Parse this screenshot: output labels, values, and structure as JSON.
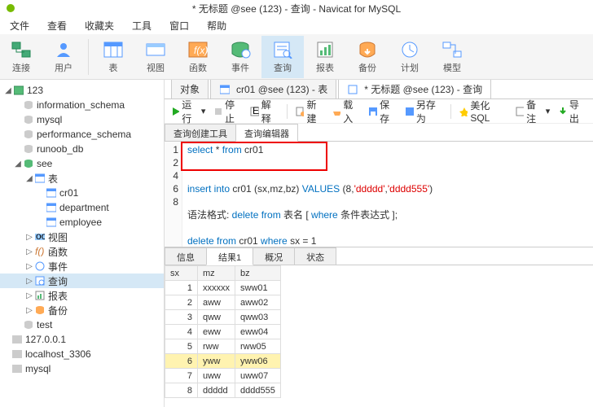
{
  "titlebar": "* 无标题 @see (123) - 查询 - Navicat for MySQL",
  "menu": {
    "file": "文件",
    "view": "查看",
    "fav": "收藏夹",
    "tool": "工具",
    "window": "窗口",
    "help": "帮助"
  },
  "ribbon": {
    "conn": "连接",
    "user": "用户",
    "table": "表",
    "view": "视图",
    "func": "函数",
    "event": "事件",
    "query": "查询",
    "report": "报表",
    "backup": "备份",
    "plan": "计划",
    "model": "模型"
  },
  "tree": {
    "root": "123",
    "dbs": [
      "information_schema",
      "mysql",
      "performance_schema",
      "runoob_db"
    ],
    "see": "see",
    "tables_label": "表",
    "tables": [
      "cr01",
      "department",
      "employee"
    ],
    "views": "视图",
    "funcs": "函数",
    "events": "事件",
    "queries": "查询",
    "reports": "报表",
    "backups": "备份",
    "test": "test",
    "hosts": [
      "127.0.0.1",
      "localhost_3306",
      "mysql"
    ]
  },
  "tabs": {
    "objects": "对象",
    "t1": "cr01 @see (123) - 表",
    "t2": "* 无标题 @see (123) - 查询"
  },
  "toolbar": {
    "run": "运行",
    "stop": "停止",
    "explain": "解释",
    "new": "新建",
    "load": "载入",
    "save": "保存",
    "saveas": "另存为",
    "beautify": "美化 SQL",
    "note": "备注",
    "export": "导出"
  },
  "subtabs": {
    "builder": "查询创建工具",
    "editor": "查询编辑器"
  },
  "sql": {
    "l1": {
      "a": "select",
      "b": " * ",
      "c": "from",
      "d": " cr01"
    },
    "l4": {
      "a": "insert into",
      "b": " cr01 (sx,mz,bz) ",
      "c": "VALUES",
      "d": " (",
      "e": "8",
      "f": ",",
      "g": "'ddddd'",
      "h": ",",
      "i": "'dddd555'",
      "j": ")"
    },
    "l6": {
      "a": "语法格式: ",
      "b": "delete from",
      "c": " 表名 [ ",
      "d": "where",
      "e": " 条件表达式 ];"
    },
    "l8": {
      "a": "delete from",
      "b": " cr01 ",
      "c": "where",
      "d": " sx = ",
      "e": "1"
    }
  },
  "gutter": [
    "1",
    "2",
    "",
    "4",
    "",
    "6",
    "",
    "8"
  ],
  "restabs": {
    "info": "信息",
    "result": "结果1",
    "profile": "概况",
    "status": "状态"
  },
  "cols": {
    "sx": "sx",
    "mz": "mz",
    "bz": "bz"
  },
  "rows": [
    {
      "sx": "1",
      "mz": "xxxxxx",
      "bz": "sww01"
    },
    {
      "sx": "2",
      "mz": "aww",
      "bz": "aww02"
    },
    {
      "sx": "3",
      "mz": "qww",
      "bz": "qww03"
    },
    {
      "sx": "4",
      "mz": "eww",
      "bz": "eww04"
    },
    {
      "sx": "5",
      "mz": "rww",
      "bz": "rww05"
    },
    {
      "sx": "6",
      "mz": "yww",
      "bz": "yww06"
    },
    {
      "sx": "7",
      "mz": "uww",
      "bz": "uww07"
    },
    {
      "sx": "8",
      "mz": "ddddd",
      "bz": "dddd555"
    }
  ]
}
